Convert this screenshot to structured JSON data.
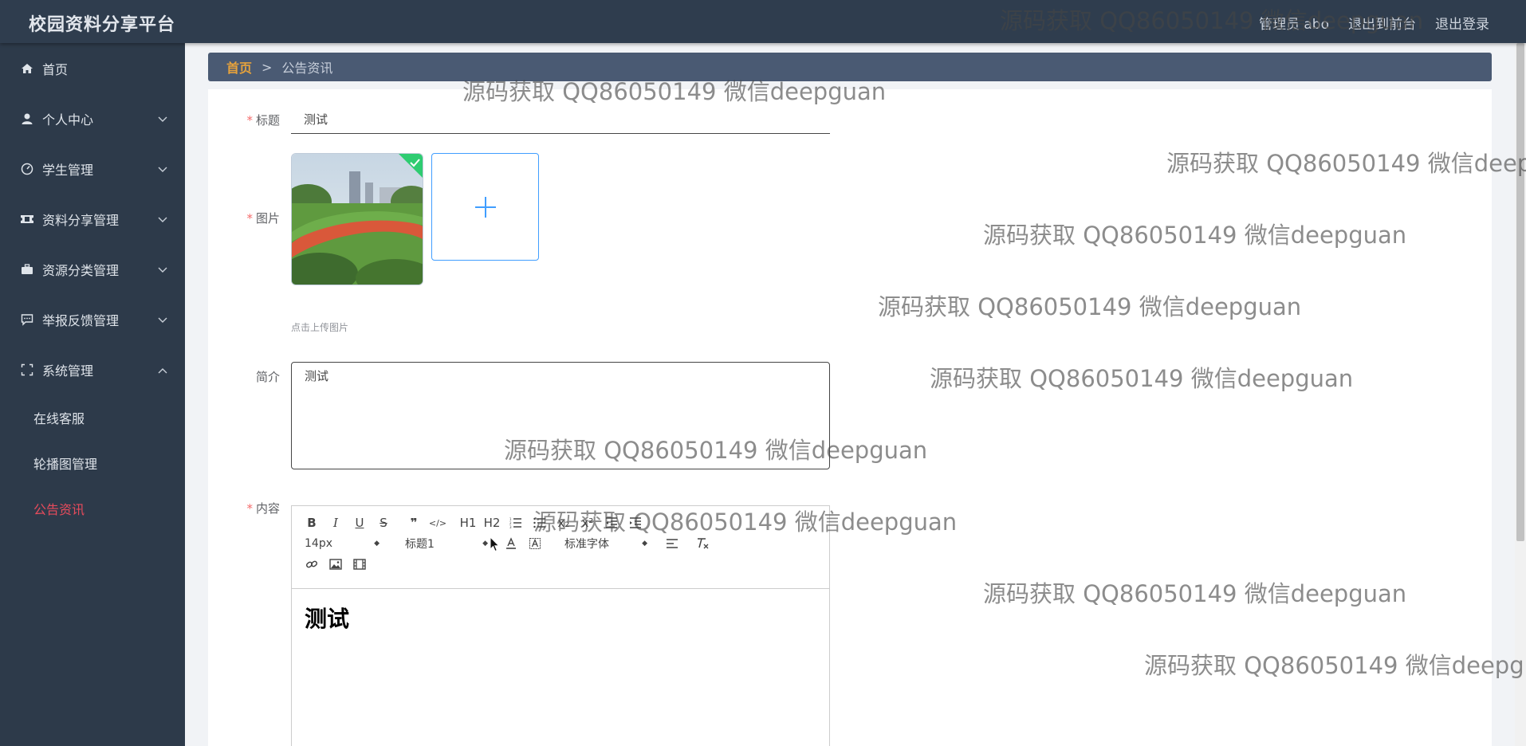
{
  "app": {
    "brand": "校园资料分享平台",
    "top_links": [
      "管理员 abo",
      "退出到前台",
      "退出登录"
    ]
  },
  "sidebar": {
    "items": [
      {
        "label": "首页",
        "icon": "home-icon",
        "expandable": false
      },
      {
        "label": "个人中心",
        "icon": "user-icon",
        "expandable": true,
        "expanded": false
      },
      {
        "label": "学生管理",
        "icon": "gauge-icon",
        "expandable": true,
        "expanded": false
      },
      {
        "label": "资料分享管理",
        "icon": "ticket-icon",
        "expandable": true,
        "expanded": false
      },
      {
        "label": "资源分类管理",
        "icon": "briefcase-icon",
        "expandable": true,
        "expanded": false
      },
      {
        "label": "举报反馈管理",
        "icon": "chat-icon",
        "expandable": true,
        "expanded": false
      },
      {
        "label": "系统管理",
        "icon": "fullscreen-icon",
        "expandable": true,
        "expanded": true
      }
    ],
    "subitems": [
      {
        "label": "在线客服",
        "active": false
      },
      {
        "label": "轮播图管理",
        "active": false
      },
      {
        "label": "公告资讯",
        "active": true
      }
    ],
    "active_color": "#e64b5c"
  },
  "breadcrumb": {
    "home": "首页",
    "separator": ">",
    "current": "公告资讯"
  },
  "form": {
    "title": {
      "label": "标题",
      "required": true,
      "value": "测试"
    },
    "image": {
      "label": "图片",
      "required": true,
      "upload_tip": "点击上传图片",
      "upload_symbol": "+"
    },
    "intro": {
      "label": "简介",
      "required": false,
      "value": "测试"
    },
    "content": {
      "label": "内容",
      "required": true,
      "body_text": "测试",
      "toolbar": {
        "row1": [
          "B",
          "I",
          "U",
          "S",
          "❞",
          "</>",
          "H1",
          "H2",
          "ol",
          "ul",
          "x₂",
          "x²",
          "outdent",
          "indent"
        ],
        "font_size": "14px",
        "heading": "标题1",
        "font_family": "标准字体"
      }
    }
  },
  "watermark_text": "源码获取 QQ86050149 微信deepguan",
  "colors": {
    "topbar": "#2f3d4e",
    "sidebar": "#2d3a4a",
    "breadcrumb": "#4a5a73",
    "breadcrumb_home": "#e6a23c",
    "required": "#f56c6c",
    "upload_border": "#409eff"
  }
}
